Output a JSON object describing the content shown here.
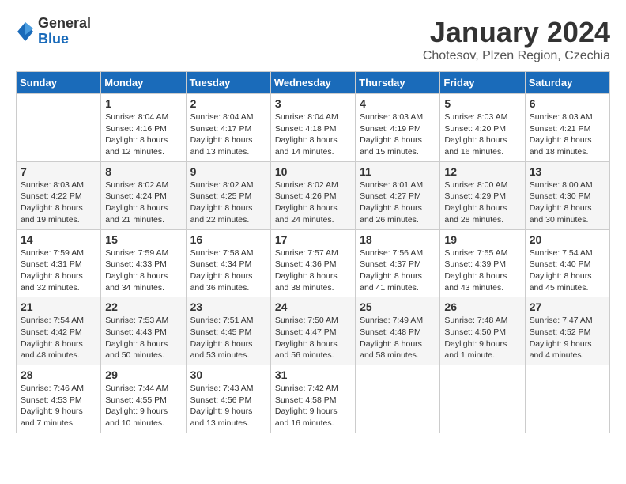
{
  "logo": {
    "general": "General",
    "blue": "Blue"
  },
  "header": {
    "month": "January 2024",
    "location": "Chotesov, Plzen Region, Czechia"
  },
  "weekdays": [
    "Sunday",
    "Monday",
    "Tuesday",
    "Wednesday",
    "Thursday",
    "Friday",
    "Saturday"
  ],
  "weeks": [
    [
      {
        "day": "",
        "sunrise": "",
        "sunset": "",
        "daylight": ""
      },
      {
        "day": "1",
        "sunrise": "Sunrise: 8:04 AM",
        "sunset": "Sunset: 4:16 PM",
        "daylight": "Daylight: 8 hours and 12 minutes."
      },
      {
        "day": "2",
        "sunrise": "Sunrise: 8:04 AM",
        "sunset": "Sunset: 4:17 PM",
        "daylight": "Daylight: 8 hours and 13 minutes."
      },
      {
        "day": "3",
        "sunrise": "Sunrise: 8:04 AM",
        "sunset": "Sunset: 4:18 PM",
        "daylight": "Daylight: 8 hours and 14 minutes."
      },
      {
        "day": "4",
        "sunrise": "Sunrise: 8:03 AM",
        "sunset": "Sunset: 4:19 PM",
        "daylight": "Daylight: 8 hours and 15 minutes."
      },
      {
        "day": "5",
        "sunrise": "Sunrise: 8:03 AM",
        "sunset": "Sunset: 4:20 PM",
        "daylight": "Daylight: 8 hours and 16 minutes."
      },
      {
        "day": "6",
        "sunrise": "Sunrise: 8:03 AM",
        "sunset": "Sunset: 4:21 PM",
        "daylight": "Daylight: 8 hours and 18 minutes."
      }
    ],
    [
      {
        "day": "7",
        "sunrise": "Sunrise: 8:03 AM",
        "sunset": "Sunset: 4:22 PM",
        "daylight": "Daylight: 8 hours and 19 minutes."
      },
      {
        "day": "8",
        "sunrise": "Sunrise: 8:02 AM",
        "sunset": "Sunset: 4:24 PM",
        "daylight": "Daylight: 8 hours and 21 minutes."
      },
      {
        "day": "9",
        "sunrise": "Sunrise: 8:02 AM",
        "sunset": "Sunset: 4:25 PM",
        "daylight": "Daylight: 8 hours and 22 minutes."
      },
      {
        "day": "10",
        "sunrise": "Sunrise: 8:02 AM",
        "sunset": "Sunset: 4:26 PM",
        "daylight": "Daylight: 8 hours and 24 minutes."
      },
      {
        "day": "11",
        "sunrise": "Sunrise: 8:01 AM",
        "sunset": "Sunset: 4:27 PM",
        "daylight": "Daylight: 8 hours and 26 minutes."
      },
      {
        "day": "12",
        "sunrise": "Sunrise: 8:00 AM",
        "sunset": "Sunset: 4:29 PM",
        "daylight": "Daylight: 8 hours and 28 minutes."
      },
      {
        "day": "13",
        "sunrise": "Sunrise: 8:00 AM",
        "sunset": "Sunset: 4:30 PM",
        "daylight": "Daylight: 8 hours and 30 minutes."
      }
    ],
    [
      {
        "day": "14",
        "sunrise": "Sunrise: 7:59 AM",
        "sunset": "Sunset: 4:31 PM",
        "daylight": "Daylight: 8 hours and 32 minutes."
      },
      {
        "day": "15",
        "sunrise": "Sunrise: 7:59 AM",
        "sunset": "Sunset: 4:33 PM",
        "daylight": "Daylight: 8 hours and 34 minutes."
      },
      {
        "day": "16",
        "sunrise": "Sunrise: 7:58 AM",
        "sunset": "Sunset: 4:34 PM",
        "daylight": "Daylight: 8 hours and 36 minutes."
      },
      {
        "day": "17",
        "sunrise": "Sunrise: 7:57 AM",
        "sunset": "Sunset: 4:36 PM",
        "daylight": "Daylight: 8 hours and 38 minutes."
      },
      {
        "day": "18",
        "sunrise": "Sunrise: 7:56 AM",
        "sunset": "Sunset: 4:37 PM",
        "daylight": "Daylight: 8 hours and 41 minutes."
      },
      {
        "day": "19",
        "sunrise": "Sunrise: 7:55 AM",
        "sunset": "Sunset: 4:39 PM",
        "daylight": "Daylight: 8 hours and 43 minutes."
      },
      {
        "day": "20",
        "sunrise": "Sunrise: 7:54 AM",
        "sunset": "Sunset: 4:40 PM",
        "daylight": "Daylight: 8 hours and 45 minutes."
      }
    ],
    [
      {
        "day": "21",
        "sunrise": "Sunrise: 7:54 AM",
        "sunset": "Sunset: 4:42 PM",
        "daylight": "Daylight: 8 hours and 48 minutes."
      },
      {
        "day": "22",
        "sunrise": "Sunrise: 7:53 AM",
        "sunset": "Sunset: 4:43 PM",
        "daylight": "Daylight: 8 hours and 50 minutes."
      },
      {
        "day": "23",
        "sunrise": "Sunrise: 7:51 AM",
        "sunset": "Sunset: 4:45 PM",
        "daylight": "Daylight: 8 hours and 53 minutes."
      },
      {
        "day": "24",
        "sunrise": "Sunrise: 7:50 AM",
        "sunset": "Sunset: 4:47 PM",
        "daylight": "Daylight: 8 hours and 56 minutes."
      },
      {
        "day": "25",
        "sunrise": "Sunrise: 7:49 AM",
        "sunset": "Sunset: 4:48 PM",
        "daylight": "Daylight: 8 hours and 58 minutes."
      },
      {
        "day": "26",
        "sunrise": "Sunrise: 7:48 AM",
        "sunset": "Sunset: 4:50 PM",
        "daylight": "Daylight: 9 hours and 1 minute."
      },
      {
        "day": "27",
        "sunrise": "Sunrise: 7:47 AM",
        "sunset": "Sunset: 4:52 PM",
        "daylight": "Daylight: 9 hours and 4 minutes."
      }
    ],
    [
      {
        "day": "28",
        "sunrise": "Sunrise: 7:46 AM",
        "sunset": "Sunset: 4:53 PM",
        "daylight": "Daylight: 9 hours and 7 minutes."
      },
      {
        "day": "29",
        "sunrise": "Sunrise: 7:44 AM",
        "sunset": "Sunset: 4:55 PM",
        "daylight": "Daylight: 9 hours and 10 minutes."
      },
      {
        "day": "30",
        "sunrise": "Sunrise: 7:43 AM",
        "sunset": "Sunset: 4:56 PM",
        "daylight": "Daylight: 9 hours and 13 minutes."
      },
      {
        "day": "31",
        "sunrise": "Sunrise: 7:42 AM",
        "sunset": "Sunset: 4:58 PM",
        "daylight": "Daylight: 9 hours and 16 minutes."
      },
      {
        "day": "",
        "sunrise": "",
        "sunset": "",
        "daylight": ""
      },
      {
        "day": "",
        "sunrise": "",
        "sunset": "",
        "daylight": ""
      },
      {
        "day": "",
        "sunrise": "",
        "sunset": "",
        "daylight": ""
      }
    ]
  ]
}
